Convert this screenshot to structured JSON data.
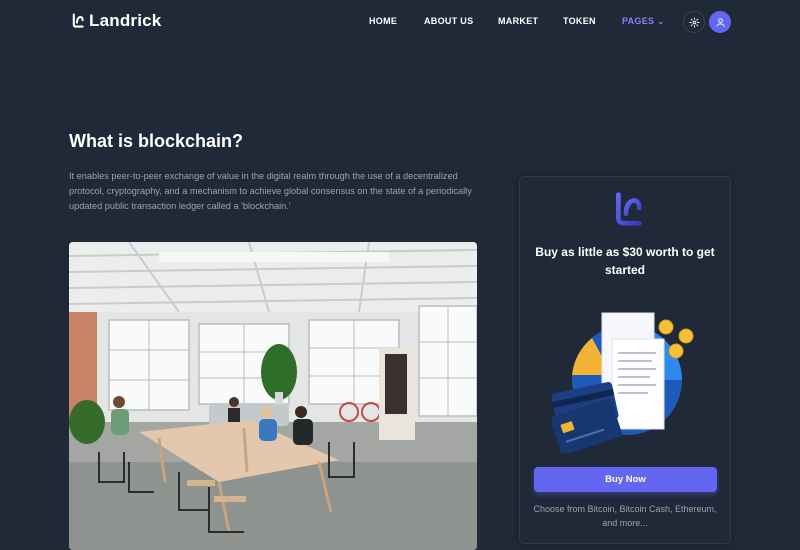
{
  "brand": {
    "name": "Landrick",
    "accent": "#6366f1",
    "background": "#1f2937"
  },
  "nav": {
    "items": [
      {
        "label": "HOME"
      },
      {
        "label": "ABOUT US"
      },
      {
        "label": "MARKET"
      },
      {
        "label": "TOKEN"
      },
      {
        "label": "PAGES",
        "active": true,
        "icon": "chevron-down-icon"
      }
    ],
    "settings_icon": "gear-icon",
    "profile_icon": "user-icon"
  },
  "main": {
    "title": "What is blockchain?",
    "description": "It enables peer-to-peer exchange of value in the digital realm through the use of a decentralized protocol, cryptography, and a mechanism to achieve global consensus on the state of a periodically updated public transaction ledger called a 'blockchain.'"
  },
  "card": {
    "title": "Buy as little as $30 worth to get started",
    "button_label": "Buy Now",
    "note": "Choose from Bitcoin, Bitcoin Cash, Ethereum, and more..."
  }
}
